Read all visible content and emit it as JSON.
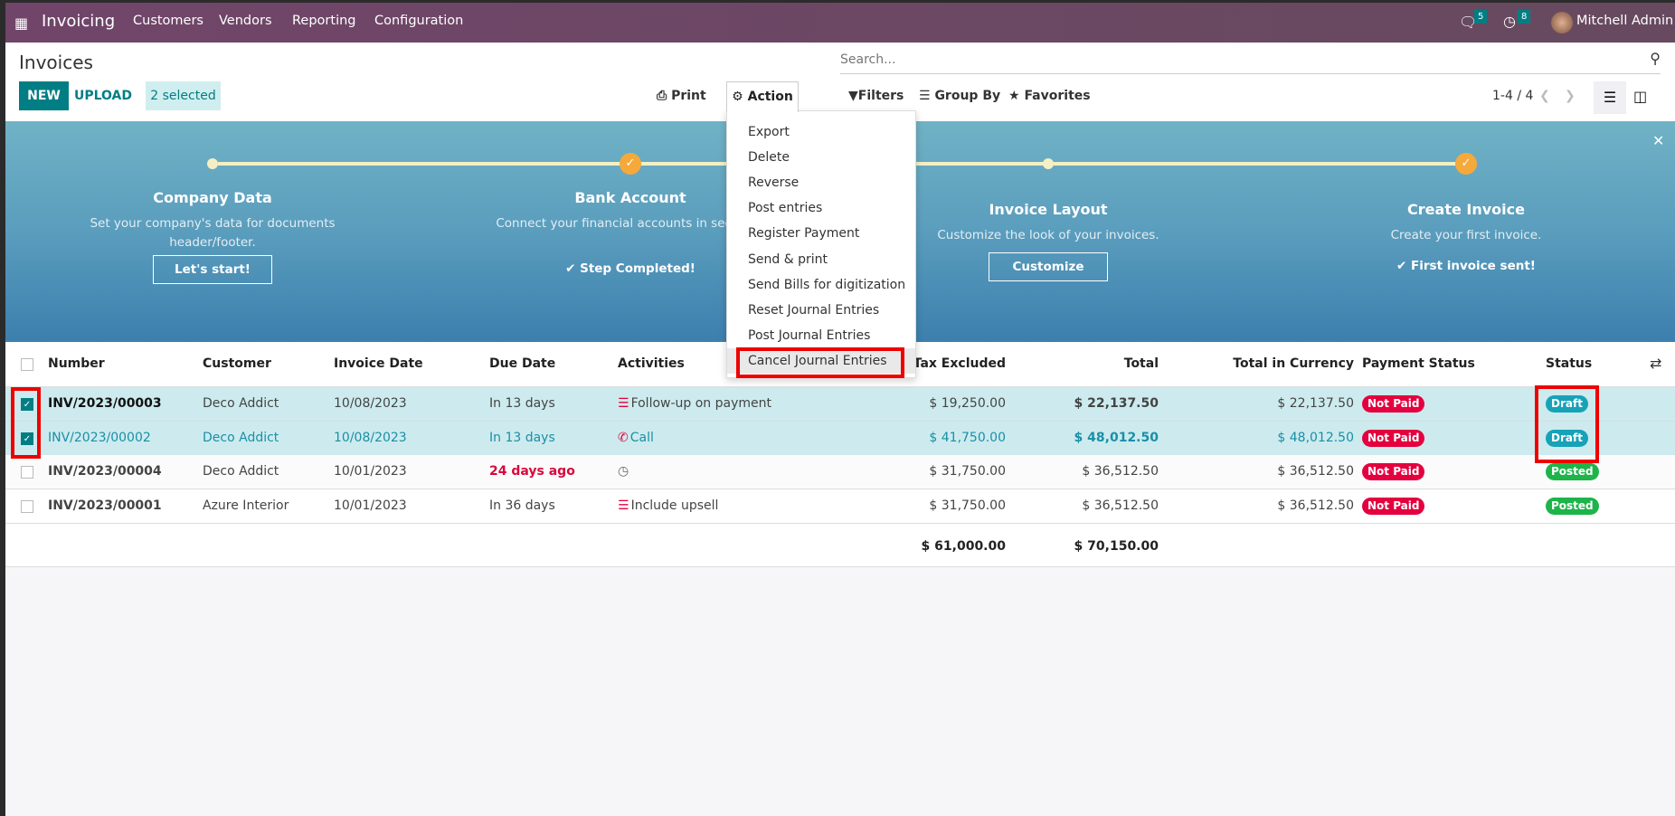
{
  "nav": {
    "app_name": "Invoicing",
    "menu": [
      "Customers",
      "Vendors",
      "Reporting",
      "Configuration"
    ],
    "messages_count": "5",
    "activities_count": "8",
    "user": "Mitchell Admin",
    "color": "#714B67"
  },
  "page": {
    "title": "Invoices"
  },
  "toolbar": {
    "new": "NEW",
    "upload": "UPLOAD",
    "selected": "2 selected",
    "print": "Print",
    "action": "Action"
  },
  "search": {
    "placeholder": "Search...",
    "filters": "Filters",
    "group_by": "Group By",
    "favorites": "Favorites",
    "pager": "1-4 / 4"
  },
  "action_menu": {
    "items": [
      "Export",
      "Delete",
      "Reverse",
      "Post entries",
      "Register Payment",
      "Send & print",
      "Send Bills for digitization",
      "Reset Journal Entries",
      "Post Journal Entries",
      "Cancel Journal Entries"
    ],
    "highlighted": "Cancel Journal Entries"
  },
  "onboarding": {
    "steps": [
      {
        "title": "Company Data",
        "desc": "Set your company's data for documents header/footer.",
        "button": "Let's start!",
        "done": false
      },
      {
        "title": "Bank Account",
        "desc": "Connect your financial accounts in seconds.",
        "completed": "Step Completed!",
        "done": true
      },
      {
        "title": "Invoice Layout",
        "desc": "Customize the look of your invoices.",
        "button": "Customize",
        "done": false
      },
      {
        "title": "Create Invoice",
        "desc": "Create your first invoice.",
        "completed": "First invoice sent!",
        "done": true
      }
    ]
  },
  "table": {
    "columns": [
      "Number",
      "Customer",
      "Invoice Date",
      "Due Date",
      "Activities",
      "Tax Excluded",
      "Total",
      "Total in Currency",
      "Payment Status",
      "Status"
    ],
    "rows": [
      {
        "selected": true,
        "number": "INV/2023/00003",
        "customer": "Deco Addict",
        "invoice_date": "10/08/2023",
        "due_date": "In 13 days",
        "activity_icon": "list-icon",
        "activity": "Follow-up on payment",
        "tax_excluded": "$ 19,250.00",
        "total": "$ 22,137.50",
        "total_currency": "$ 22,137.50",
        "payment_status": "Not Paid",
        "status": "Draft"
      },
      {
        "selected": true,
        "number": "INV/2023/00002",
        "customer": "Deco Addict",
        "invoice_date": "10/08/2023",
        "due_date": "In 13 days",
        "activity_icon": "phone-icon",
        "activity": "Call",
        "tax_excluded": "$ 41,750.00",
        "total": "$ 48,012.50",
        "total_currency": "$ 48,012.50",
        "payment_status": "Not Paid",
        "status": "Draft"
      },
      {
        "selected": false,
        "number": "INV/2023/00004",
        "customer": "Deco Addict",
        "invoice_date": "10/01/2023",
        "due_date": "24 days ago",
        "overdue": true,
        "activity_icon": "clock-icon",
        "activity": "",
        "tax_excluded": "$ 31,750.00",
        "total": "$ 36,512.50",
        "total_currency": "$ 36,512.50",
        "payment_status": "Not Paid",
        "status": "Posted"
      },
      {
        "selected": false,
        "number": "INV/2023/00001",
        "customer": "Azure Interior",
        "invoice_date": "10/01/2023",
        "due_date": "In 36 days",
        "activity_icon": "list-icon",
        "activity": "Include upsell",
        "tax_excluded": "$ 31,750.00",
        "total": "$ 36,512.50",
        "total_currency": "$ 36,512.50",
        "payment_status": "Not Paid",
        "status": "Posted"
      }
    ],
    "totals": {
      "tax_excluded": "$ 61,000.00",
      "total": "$ 70,150.00"
    }
  },
  "colors": {
    "primary": "#017e84",
    "not_paid": "#e4003f",
    "draft": "#17a2b8",
    "posted": "#1db44a",
    "selected_row": "#cdebee",
    "highlight": "#ee0000"
  }
}
